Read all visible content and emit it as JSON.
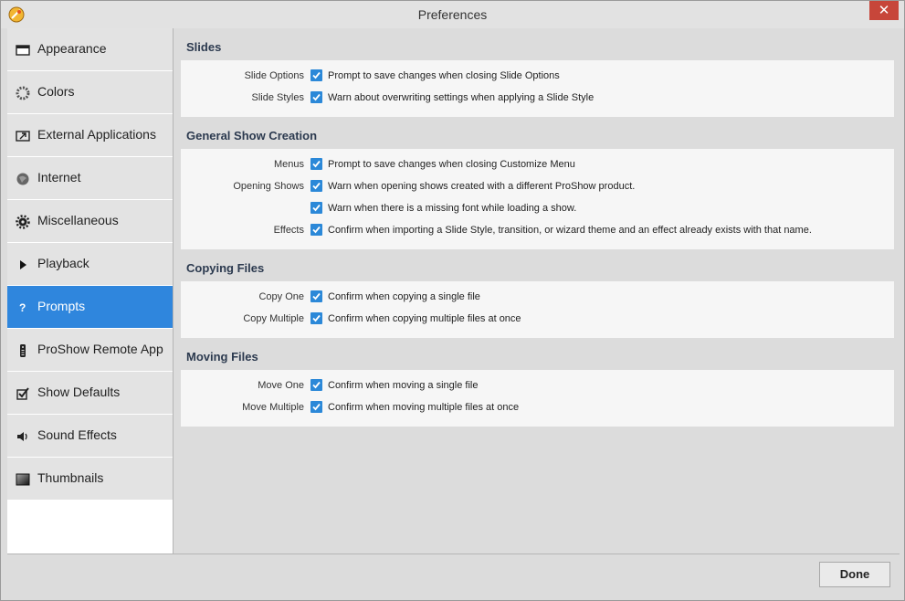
{
  "window": {
    "title": "Preferences",
    "close_label": "✕"
  },
  "sidebar": {
    "items": [
      {
        "label": "Appearance",
        "icon": "appearance-icon"
      },
      {
        "label": "Colors",
        "icon": "colors-icon"
      },
      {
        "label": "External Applications",
        "icon": "external-applications-icon"
      },
      {
        "label": "Internet",
        "icon": "internet-icon"
      },
      {
        "label": "Miscellaneous",
        "icon": "gear-icon"
      },
      {
        "label": "Playback",
        "icon": "play-icon"
      },
      {
        "label": "Prompts",
        "icon": "question-icon",
        "active": true
      },
      {
        "label": "ProShow Remote App",
        "icon": "remote-icon"
      },
      {
        "label": "Show Defaults",
        "icon": "checkbox-icon"
      },
      {
        "label": "Sound Effects",
        "icon": "speaker-icon"
      },
      {
        "label": "Thumbnails",
        "icon": "thumbnails-icon"
      }
    ]
  },
  "sections": [
    {
      "title": "Slides",
      "rows": [
        {
          "label": "Slide Options",
          "text": "Prompt to save changes when closing Slide Options",
          "checked": true
        },
        {
          "label": "Slide Styles",
          "text": "Warn about overwriting settings when applying a Slide Style",
          "checked": true
        }
      ]
    },
    {
      "title": "General Show Creation",
      "rows": [
        {
          "label": "Menus",
          "text": "Prompt to save changes when closing Customize Menu",
          "checked": true
        },
        {
          "label": "Opening Shows",
          "text": "Warn when opening shows created with a different ProShow product.",
          "checked": true
        },
        {
          "label": "",
          "text": "Warn when there is a missing font while loading a show.",
          "checked": true
        },
        {
          "label": "Effects",
          "text": "Confirm when importing a Slide Style, transition, or wizard theme and an effect already exists with that name.",
          "checked": true
        }
      ]
    },
    {
      "title": "Copying Files",
      "rows": [
        {
          "label": "Copy One",
          "text": "Confirm when copying a single file",
          "checked": true
        },
        {
          "label": "Copy Multiple",
          "text": "Confirm when copying multiple files at once",
          "checked": true
        }
      ]
    },
    {
      "title": "Moving Files",
      "rows": [
        {
          "label": "Move One",
          "text": "Confirm when moving a single file",
          "checked": true
        },
        {
          "label": "Move Multiple",
          "text": "Confirm when moving multiple files at once",
          "checked": true
        }
      ]
    }
  ],
  "footer": {
    "done_label": "Done"
  },
  "colors": {
    "accent": "#2f86dd",
    "checkbox": "#2b88d8",
    "close": "#c7463a"
  }
}
